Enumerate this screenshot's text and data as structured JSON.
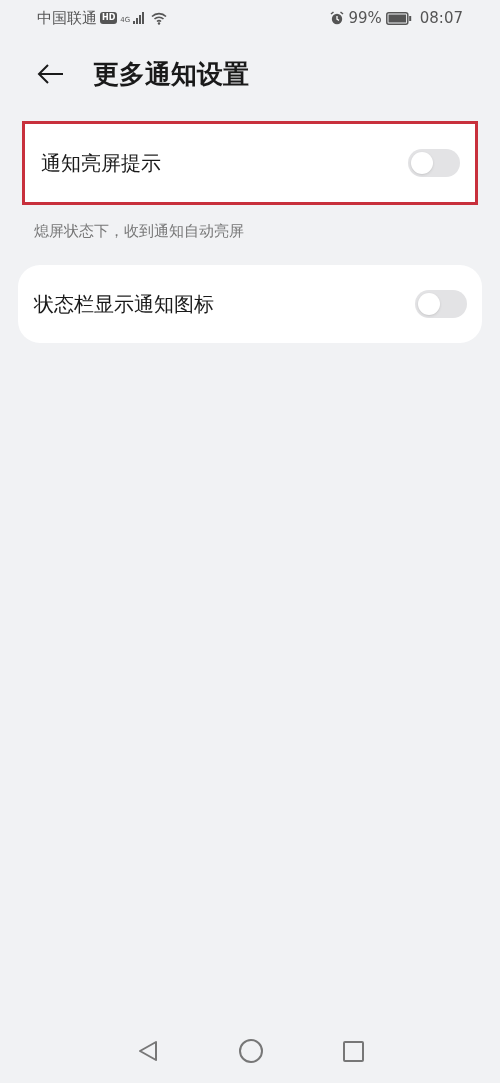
{
  "status_bar": {
    "carrier": "中国联通",
    "hd_badge": "HD",
    "network": "4G",
    "battery": "99%",
    "time": "08:07"
  },
  "header": {
    "title": "更多通知设置"
  },
  "settings": [
    {
      "label": "通知亮屏提示",
      "on": false,
      "highlighted": true,
      "caption": "熄屏状态下，收到通知自动亮屏"
    },
    {
      "label": "状态栏显示通知图标",
      "on": false,
      "highlighted": false
    }
  ]
}
